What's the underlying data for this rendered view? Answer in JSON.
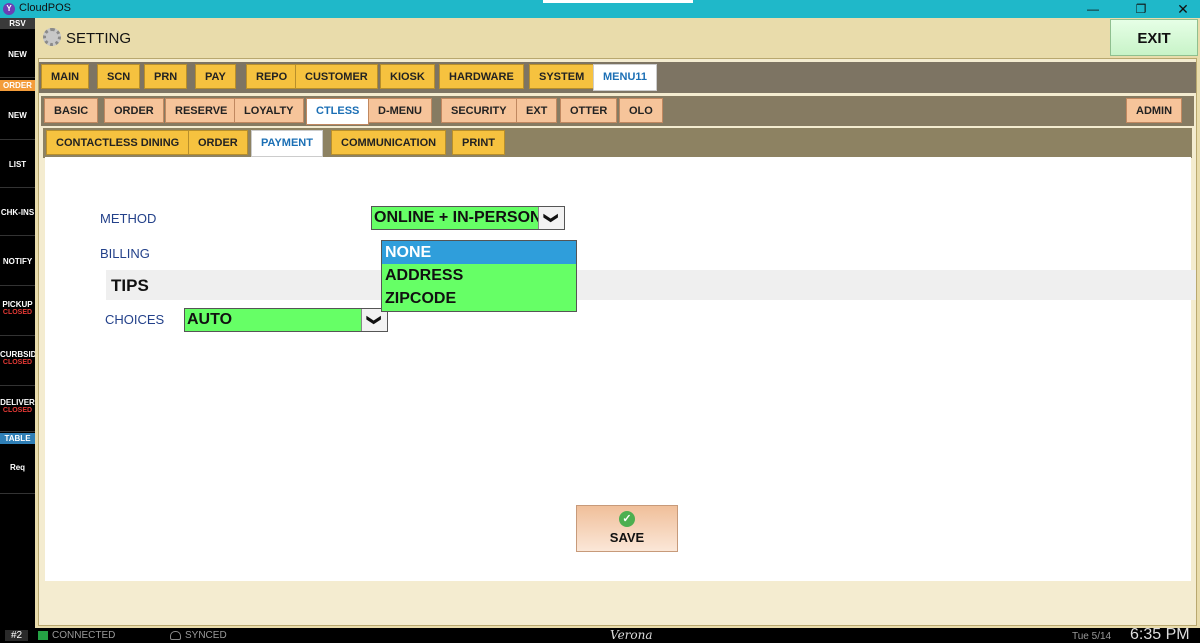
{
  "window": {
    "app_title": "CloudPOS",
    "logo_letter": "Y",
    "min": "—",
    "max": "❐",
    "close": "✕"
  },
  "sidebar": {
    "tag_rsv": "RSV",
    "tag_order": "ORDER",
    "tag_table": "TABLE",
    "items": [
      {
        "label": "NEW",
        "sub": ""
      },
      {
        "label": "NEW",
        "sub": ""
      },
      {
        "label": "LIST",
        "sub": ""
      },
      {
        "label": "CHK-INS",
        "sub": ""
      },
      {
        "label": "NOTIFY",
        "sub": ""
      },
      {
        "label": "PICKUP",
        "sub": "CLOSED"
      },
      {
        "label": "CURBSID",
        "sub": "CLOSED"
      },
      {
        "label": "DELIVER",
        "sub": "CLOSED"
      },
      {
        "label": "Req",
        "sub": ""
      }
    ]
  },
  "header": {
    "title": "SETTING",
    "exit_label": "EXIT"
  },
  "tabs_main": [
    "MAIN",
    "SCN",
    "PRN",
    "PAY",
    "REPO",
    "CUSTOMER",
    "KIOSK",
    "HARDWARE",
    "SYSTEM",
    "MENU11"
  ],
  "tabs_sub": [
    "BASIC",
    "ORDER",
    "RESERVE",
    "LOYALTY",
    "CTLESS",
    "D-MENU",
    "SECURITY",
    "EXT",
    "OTTER",
    "OLO"
  ],
  "tab_admin": "ADMIN",
  "tabs_third": [
    "CONTACTLESS DINING",
    "ORDER",
    "PAYMENT",
    "COMMUNICATION",
    "PRINT"
  ],
  "form": {
    "method_label": "METHOD",
    "method_value": "ONLINE + IN-PERSON",
    "billing_label": "BILLING",
    "billing_options": [
      "NONE",
      "ADDRESS",
      "ZIPCODE"
    ],
    "billing_selected": "NONE",
    "tips_title": "TIPS",
    "choices_label": "CHOICES",
    "choices_value": "AUTO",
    "arrow_glyph": "❯"
  },
  "save_label": "SAVE",
  "status": {
    "station": "#2",
    "connected": "CONNECTED",
    "synced": "SYNCED",
    "venue": "Verona",
    "date": "Tue 5/14",
    "time": "6:35 PM"
  },
  "colors": {
    "accent": "#1fb8c9",
    "select_green": "#66ff66",
    "selected_blue": "#2f9edb",
    "tab_yellow": "#f6c23f"
  }
}
